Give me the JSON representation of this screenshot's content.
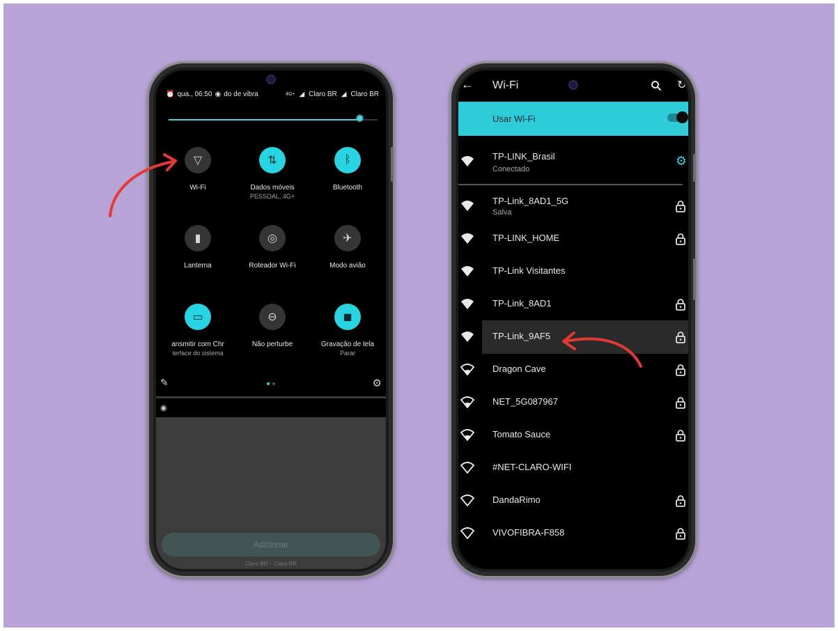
{
  "colors": {
    "background": "#b7a3d6",
    "accent": "#27d4e2",
    "arrow": "#e53935"
  },
  "left_phone": {
    "status": {
      "time": "qua., 06:50",
      "mode": "do de vibra",
      "carrier1": "Claro BR",
      "carrier2": "Claro BR",
      "network": "4G+"
    },
    "brightness_level": 0.88,
    "tiles": [
      {
        "label": "Wi-Fi",
        "sub": "",
        "on": false,
        "icon": "wifi-icon"
      },
      {
        "label": "Dados móveis",
        "sub": "PESSOAL, 4G+",
        "on": true,
        "icon": "mobile-data-icon"
      },
      {
        "label": "Bluetooth",
        "sub": "",
        "on": true,
        "icon": "bluetooth-icon"
      },
      {
        "label": "Lanterna",
        "sub": "",
        "on": false,
        "icon": "flashlight-icon"
      },
      {
        "label": "Roteador Wi-Fi",
        "sub": "",
        "on": false,
        "icon": "hotspot-icon"
      },
      {
        "label": "Modo avião",
        "sub": "",
        "on": false,
        "icon": "airplane-icon"
      },
      {
        "label": "ansmitir com Chr",
        "sub": "terface do sistema",
        "on": true,
        "icon": "cast-icon"
      },
      {
        "label": "Não perturbe",
        "sub": "",
        "on": false,
        "icon": "dnd-icon"
      },
      {
        "label": "Gravação de tela",
        "sub": "Parar",
        "on": true,
        "icon": "screen-record-icon"
      }
    ],
    "add_button": "Adicionar",
    "footer": "Claro BR – Claro BR"
  },
  "right_phone": {
    "title": "Wi-Fi",
    "use_wifi_label": "Usar Wi-Fi",
    "use_wifi_on": true,
    "connected": {
      "name": "TP-LINK_Brasil",
      "status": "Conectado"
    },
    "networks": [
      {
        "name": "TP-Link_8AD1_5G",
        "status": "Salva",
        "locked": true,
        "strength": "full"
      },
      {
        "name": "TP-LINK_HOME",
        "status": "",
        "locked": true,
        "strength": "full"
      },
      {
        "name": "TP-Link Visitantes",
        "status": "",
        "locked": false,
        "strength": "full"
      },
      {
        "name": "TP-Link_8AD1",
        "status": "",
        "locked": true,
        "strength": "full"
      },
      {
        "name": "TP-Link_9AF5",
        "status": "",
        "locked": true,
        "strength": "full",
        "highlighted": true
      },
      {
        "name": "Dragon Cave",
        "status": "",
        "locked": true,
        "strength": "medium"
      },
      {
        "name": "NET_5G087967",
        "status": "",
        "locked": true,
        "strength": "medium"
      },
      {
        "name": "Tomato Sauce",
        "status": "",
        "locked": true,
        "strength": "medium"
      },
      {
        "name": "#NET-CLARO-WIFI",
        "status": "",
        "locked": false,
        "strength": "weak"
      },
      {
        "name": "DandaRimo",
        "status": "",
        "locked": true,
        "strength": "weak"
      },
      {
        "name": "VIVOFIBRA-F858",
        "status": "",
        "locked": true,
        "strength": "weak"
      }
    ]
  }
}
